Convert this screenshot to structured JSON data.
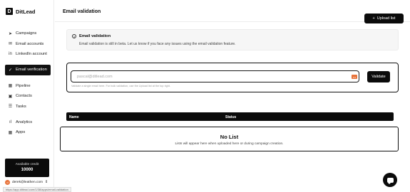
{
  "brand": {
    "name": "DitLead",
    "logo_letter": "D"
  },
  "sidebar": {
    "items": [
      {
        "label": "Campaigns",
        "icon": "send-icon",
        "glyph": "➤"
      },
      {
        "label": "Email accounts",
        "icon": "mail-icon",
        "glyph": "✉"
      },
      {
        "label": "LinkedIn account",
        "icon": "linkedin-icon",
        "glyph": "in"
      },
      {
        "label": "Email verification",
        "icon": "check-circle-icon",
        "glyph": "✓",
        "active": true
      },
      {
        "label": "Pipeline",
        "icon": "pipeline-icon",
        "glyph": "▦"
      },
      {
        "label": "Contacts",
        "icon": "contacts-icon",
        "glyph": "▣"
      },
      {
        "label": "Tasks",
        "icon": "tasks-icon",
        "glyph": "☰"
      },
      {
        "label": "Analytics",
        "icon": "analytics-icon",
        "glyph": "ıl"
      },
      {
        "label": "Apps",
        "icon": "apps-icon",
        "glyph": "▦"
      }
    ]
  },
  "credit": {
    "label": "Available credit",
    "value": "10000"
  },
  "user": {
    "email": "derek@leathen.com",
    "avatar_letter": "d",
    "menu_glyph": "⇕"
  },
  "statusbar": {
    "url": "https://app.ditlead.com/1/38/apps/email-validation"
  },
  "header": {
    "title": "Email validation",
    "upload_label": "Upload list",
    "upload_glyph": "+"
  },
  "info": {
    "title": "Email validation",
    "description": "Email validation is still in beta. Let us know if you face any issues using the email validation feature."
  },
  "validator": {
    "placeholder": "pascal@ditlead.com",
    "button_label": "Validate",
    "hint": "Validate a single email here. For bulk validation, use the Upload list at the top right."
  },
  "table": {
    "columns": [
      "Name",
      "Status"
    ]
  },
  "empty_state": {
    "title": "No List",
    "subtitle": "Lists will appear here when uploaded here or during campaign creation."
  },
  "colors": {
    "accent": "#0b0b0b",
    "avatar": "#e8733a"
  }
}
